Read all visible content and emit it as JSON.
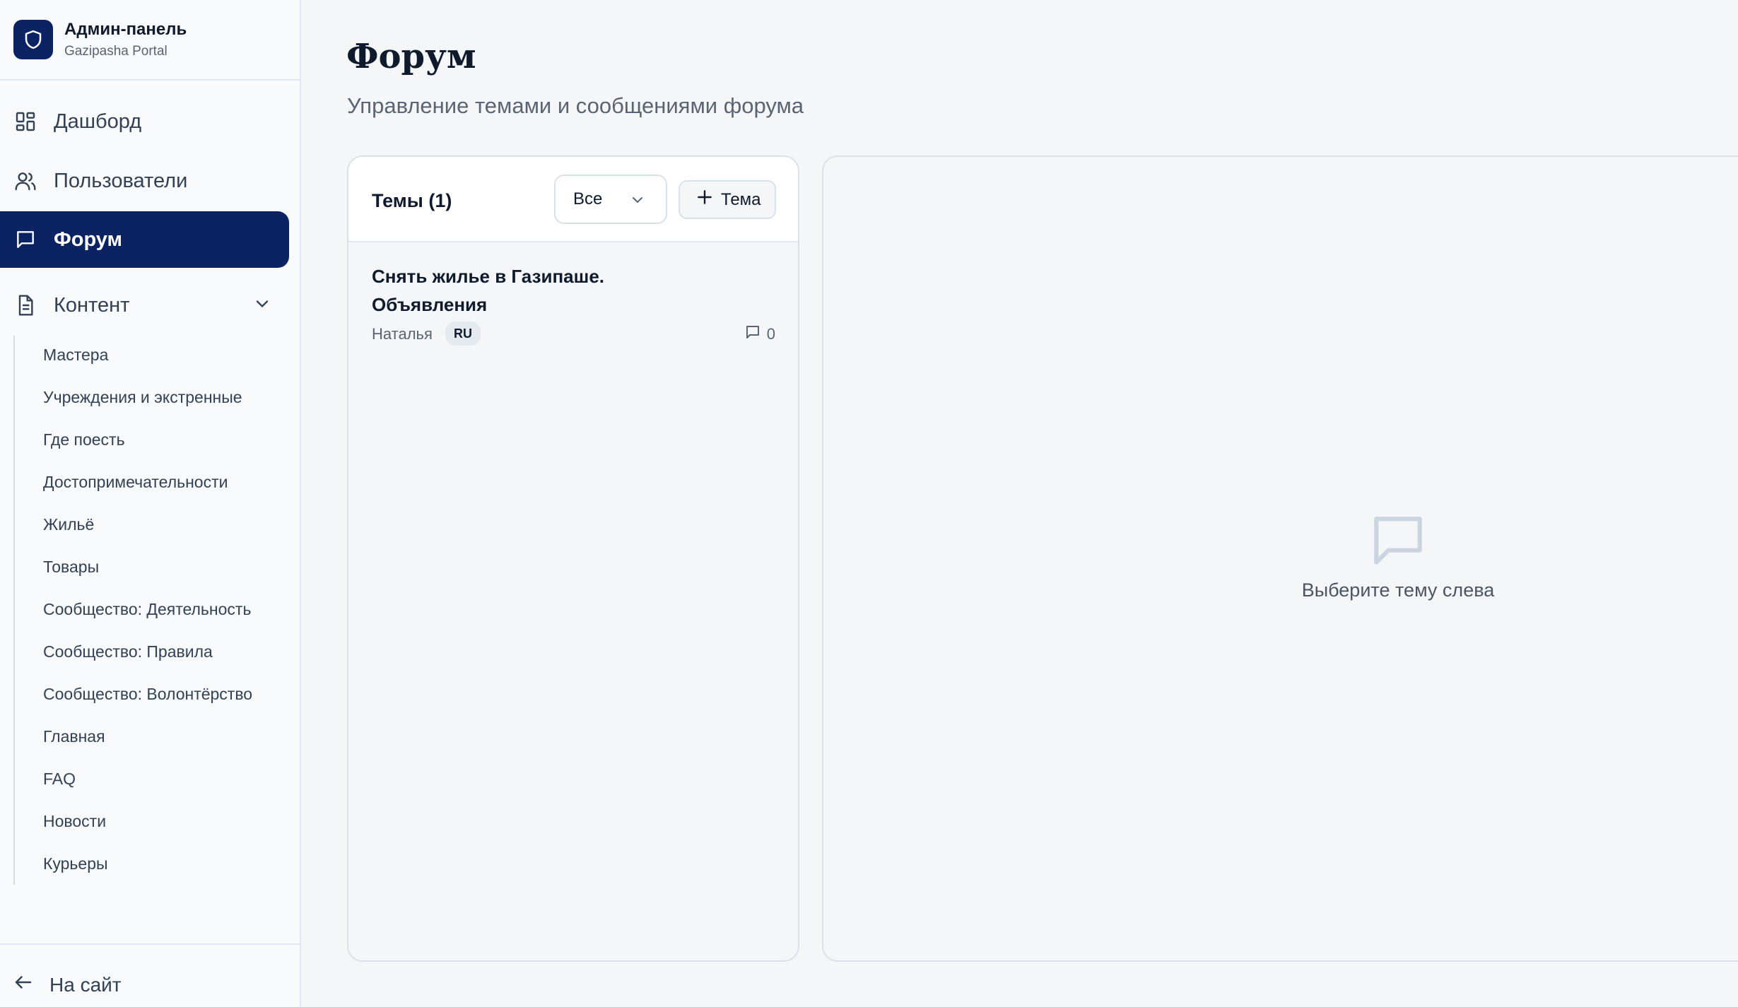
{
  "brand": {
    "title": "Админ-панель",
    "subtitle": "Gazipasha Portal",
    "logo_icon": "shield-icon",
    "logo_color": "#0b2362"
  },
  "nav": {
    "items": [
      {
        "label": "Дашборд",
        "icon": "grid-icon"
      },
      {
        "label": "Пользователи",
        "icon": "users-icon"
      },
      {
        "label": "Форум",
        "icon": "message-square-icon",
        "active": true
      },
      {
        "label": "Контент",
        "icon": "file-text-icon",
        "expanded": true
      }
    ],
    "content_items": [
      "Мастера",
      "Учреждения и экстренные",
      "Где поесть",
      "Достопримечательности",
      "Жильё",
      "Товары",
      "Сообщество: Деятельность",
      "Сообщество: Правила",
      "Сообщество: Волонтёрство",
      "Главная",
      "FAQ",
      "Новости",
      "Курьеры"
    ],
    "back_label": "На сайт",
    "active_color": "#0b2362"
  },
  "page": {
    "title": "Форум",
    "subtitle": "Управление темами и сообщениями форума"
  },
  "topics": {
    "header": "Темы (1)",
    "filter_value": "Все",
    "add_label": "Тема",
    "items": [
      {
        "title": "Снять жилье в Газипаше. Объявления",
        "author": "Наталья",
        "lang": "RU",
        "replies": "0"
      }
    ]
  },
  "detail": {
    "empty_text": "Выберите тему слева"
  }
}
